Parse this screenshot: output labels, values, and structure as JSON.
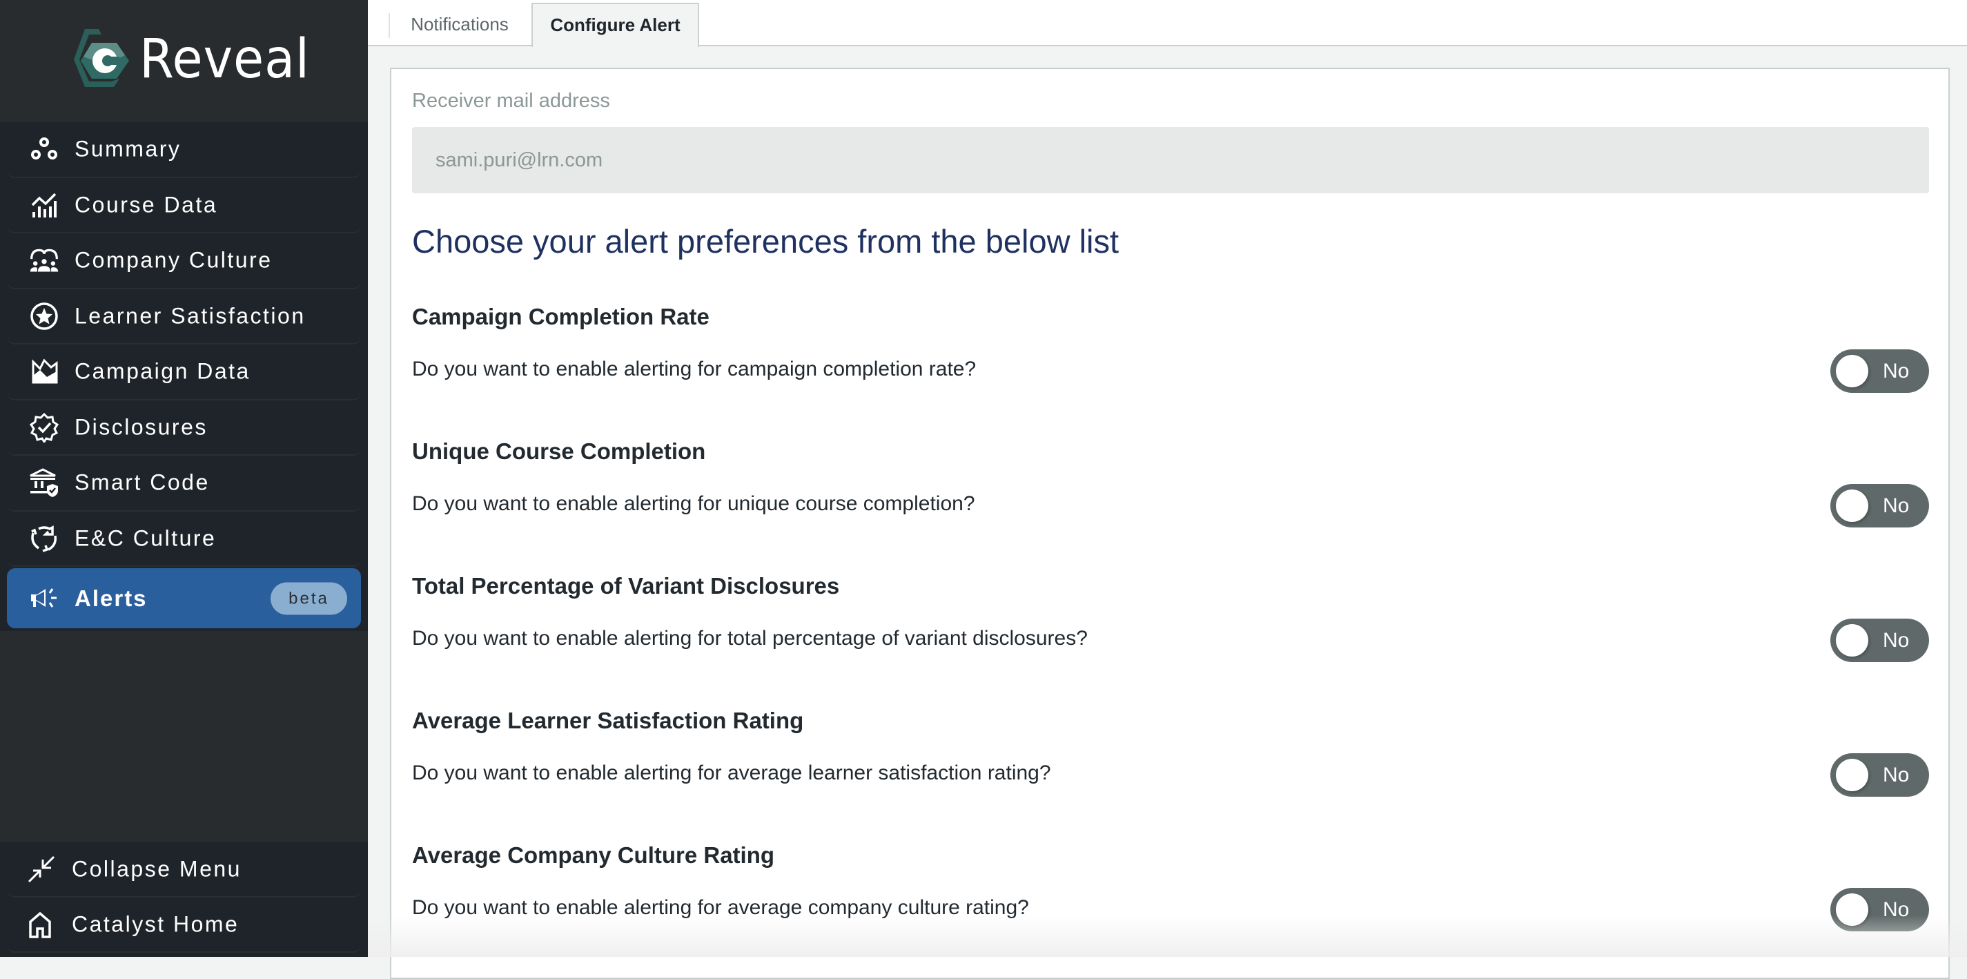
{
  "brand": {
    "name": "Reveal",
    "logo_letter": "c",
    "accent": "#2a5f5a"
  },
  "sidebar": {
    "items": [
      {
        "label": "Summary",
        "icon": "circles-icon"
      },
      {
        "label": "Course Data",
        "icon": "chart-trend-icon"
      },
      {
        "label": "Company Culture",
        "icon": "people-group-icon"
      },
      {
        "label": "Learner Satisfaction",
        "icon": "star-circle-icon"
      },
      {
        "label": "Campaign Data",
        "icon": "area-chart-icon"
      },
      {
        "label": "Disclosures",
        "icon": "badge-check-icon"
      },
      {
        "label": "Smart Code",
        "icon": "bank-shield-icon"
      },
      {
        "label": "E&C Culture",
        "icon": "refresh-cycle-icon"
      },
      {
        "label": "Alerts",
        "icon": "megaphone-icon",
        "badge": "beta",
        "active": true
      }
    ],
    "bottom": [
      {
        "label": "Collapse Menu",
        "icon": "collapse-icon"
      },
      {
        "label": "Catalyst Home",
        "icon": "home-icon"
      }
    ],
    "active_color": "#2a5f9e"
  },
  "tabs": [
    {
      "label": "Notifications",
      "active": false
    },
    {
      "label": "Configure Alert",
      "active": true
    }
  ],
  "form": {
    "email_label": "Receiver mail address",
    "email_value": "sami.puri@lrn.com",
    "heading": "Choose your alert preferences from the below list",
    "preferences": [
      {
        "title": "Campaign Completion Rate",
        "question": "Do you want to enable alerting for campaign completion rate?",
        "toggle": "No",
        "enabled": false
      },
      {
        "title": "Unique Course Completion",
        "question": "Do you want to enable alerting for unique course completion?",
        "toggle": "No",
        "enabled": false
      },
      {
        "title": "Total Percentage of Variant Disclosures",
        "question": "Do you want to enable alerting for total percentage of variant disclosures?",
        "toggle": "No",
        "enabled": false
      },
      {
        "title": "Average Learner Satisfaction Rating",
        "question": "Do you want to enable alerting for average learner satisfaction rating?",
        "toggle": "No",
        "enabled": false
      },
      {
        "title": "Average Company Culture Rating",
        "question": "Do you want to enable alerting for average company culture rating?",
        "toggle": "No",
        "enabled": false
      }
    ]
  }
}
